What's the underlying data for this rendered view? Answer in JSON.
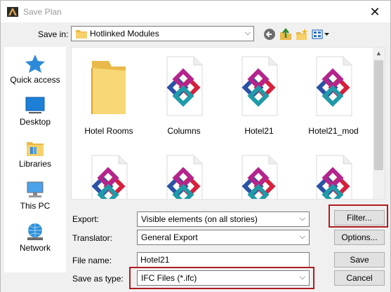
{
  "window": {
    "title": "Save Plan"
  },
  "save_in": {
    "label": "Save in:",
    "value": "Hotlinked Modules"
  },
  "places": [
    {
      "label": "Quick access",
      "icon": "quick-access-star-icon"
    },
    {
      "label": "Desktop",
      "icon": "desktop-icon"
    },
    {
      "label": "Libraries",
      "icon": "libraries-icon"
    },
    {
      "label": "This PC",
      "icon": "this-pc-icon"
    },
    {
      "label": "Network",
      "icon": "network-icon"
    }
  ],
  "files": [
    {
      "name": "Hotel Rooms",
      "type": "folder"
    },
    {
      "name": "Columns",
      "type": "ifc"
    },
    {
      "name": "Hotel21",
      "type": "ifc"
    },
    {
      "name": "Hotel21_mod",
      "type": "ifc"
    },
    {
      "name": "",
      "type": "ifc"
    },
    {
      "name": "",
      "type": "ifc"
    },
    {
      "name": "",
      "type": "ifc"
    },
    {
      "name": "",
      "type": "ifc"
    }
  ],
  "form": {
    "export_label": "Export:",
    "export_value": "Visible elements (on all stories)",
    "translator_label": "Translator:",
    "translator_value": "General Export",
    "filename_label": "File name:",
    "filename_value": "Hotel21",
    "saveas_label": "Save as type:",
    "saveas_value": "IFC Files (*.ifc)"
  },
  "buttons": {
    "filter": "Filter...",
    "options": "Options...",
    "save": "Save",
    "cancel": "Cancel"
  },
  "colors": {
    "highlight": "#b01c20",
    "folder": "#f5c94c",
    "ifc_magenta": "#b5248c",
    "ifc_red": "#d6203c",
    "ifc_blue": "#2a52a6",
    "ifc_teal": "#1f9aa8"
  }
}
